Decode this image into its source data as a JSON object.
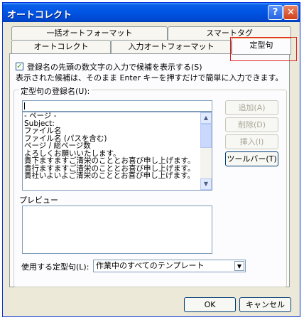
{
  "window": {
    "title": "オートコレクト",
    "help_glyph": "?",
    "close_glyph": "✕"
  },
  "tabs": {
    "back_row": [
      "一括オートフォーマット",
      "スマートタグ"
    ],
    "front_row": [
      "オートコレクト",
      "入力オートフォーマット",
      "定型句"
    ],
    "selected": "定型句"
  },
  "autotext": {
    "show_suggest_label": "登録名の先頭の数文字の入力で候補を表示する(S)",
    "show_suggest_checked": true,
    "info_text": "表示された候補は、そのまま Enter キーを押すだけで簡単に入力できます。",
    "entry_name_label": "定型句の登録名(U):",
    "entry_name_value": "",
    "list_items": [
      "- ページ -",
      "Subject:",
      "ファイル名",
      "ファイル名 (パスを含む)",
      "ページ / 総ページ数",
      "よろしくお願いいたします。",
      "貴下ますますご清栄のこととお喜び申し上げます。",
      "貴行ますますご清栄のこととお喜び申し上げます。",
      "貴社いよいよご清栄のこととお喜び申し上げます。"
    ],
    "buttons": {
      "add": "追加(A)",
      "delete": "削除(D)",
      "insert": "挿入(I)",
      "toolbar": "ツールバー(T)"
    },
    "preview_label": "プレビュー",
    "template_label": "使用する定型句(L):",
    "template_value": "作業中のすべてのテンプレート"
  },
  "footer": {
    "ok": "OK",
    "cancel": "キャンセル"
  },
  "colors": {
    "titlebar": "#0054e3",
    "tab_highlight": "#e68b2c",
    "annotation_box": "#e02020"
  }
}
